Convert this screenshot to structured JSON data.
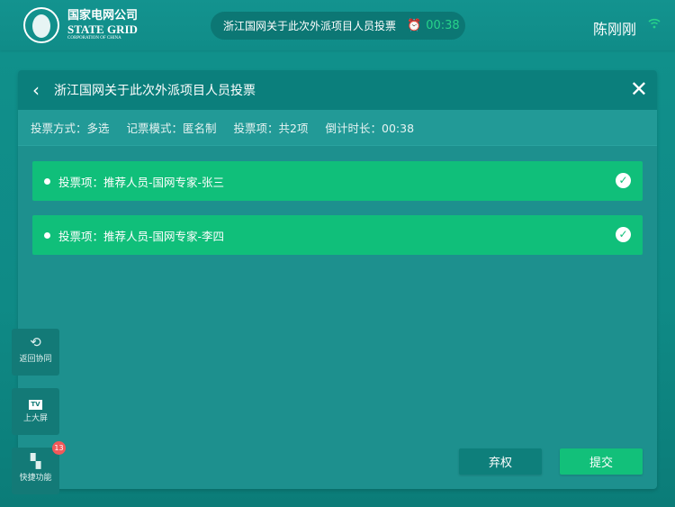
{
  "header": {
    "logo_cn": "国家电网公司",
    "logo_en": "STATE GRID",
    "logo_sub": "CORPORATION OF CHINA",
    "meeting_title": "浙江国网关于此次外派项目人员投票",
    "timer": "00:38",
    "user": "陈刚刚"
  },
  "panel": {
    "title": "浙江国网关于此次外派项目人员投票",
    "info": [
      "投票方式：多选",
      "记票模式：匿名制",
      "投票项：共2项",
      "倒计时长：00:38"
    ],
    "options": [
      {
        "label": "投票项：推荐人员-国网专家-张三",
        "checked": true
      },
      {
        "label": "投票项：推荐人员-国网专家-李四",
        "checked": true
      }
    ],
    "abstain": "弃权",
    "submit": "提交"
  },
  "sidebar": [
    {
      "label": "返回协同",
      "icon": "share-icon"
    },
    {
      "label": "上大屏",
      "icon": "tv-icon"
    },
    {
      "label": "快捷功能",
      "icon": "apps-icon",
      "badge": "13"
    }
  ],
  "colors": {
    "accent": "#10bf7a",
    "panel": "#1d908e",
    "header": "#0b7f7c"
  }
}
